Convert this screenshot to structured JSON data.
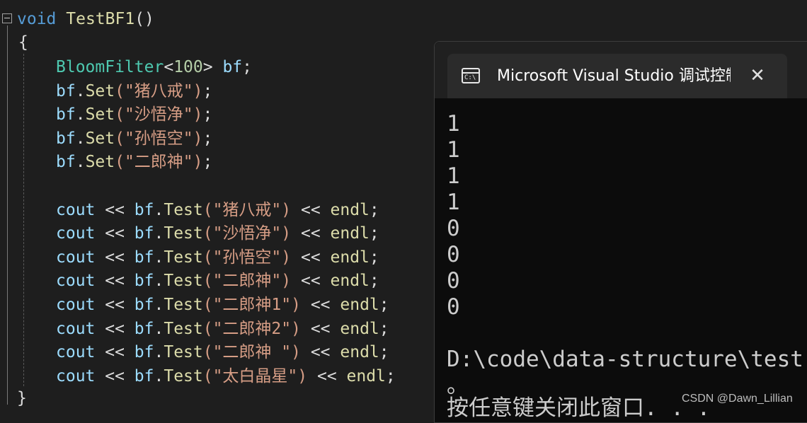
{
  "editor": {
    "function_keyword": "void",
    "function_name": "TestBF1",
    "function_parens": "()",
    "open_brace": "{",
    "close_brace": "}",
    "decl": {
      "type": "BloomFilter",
      "lt": "<",
      "size": "100",
      "gt": ">",
      "var": "bf",
      "semi": ";"
    },
    "set_lines": [
      {
        "obj": "bf",
        "method": "Set",
        "arg": "(\"猪八戒\")",
        "end": ";"
      },
      {
        "obj": "bf",
        "method": "Set",
        "arg": "(\"沙悟净\")",
        "end": ";"
      },
      {
        "obj": "bf",
        "method": "Set",
        "arg": "(\"孙悟空\")",
        "end": ";"
      },
      {
        "obj": "bf",
        "method": "Set",
        "arg": "(\"二郎神\")",
        "end": ";"
      }
    ],
    "cout_lines": [
      {
        "cout": "cout",
        "op": " << ",
        "obj": "bf",
        "method": "Test",
        "arg": "(\"猪八戒\")",
        "op2": " << ",
        "endl": "endl",
        "end": ";"
      },
      {
        "cout": "cout",
        "op": " << ",
        "obj": "bf",
        "method": "Test",
        "arg": "(\"沙悟净\")",
        "op2": " << ",
        "endl": "endl",
        "end": ";"
      },
      {
        "cout": "cout",
        "op": " << ",
        "obj": "bf",
        "method": "Test",
        "arg": "(\"孙悟空\")",
        "op2": " << ",
        "endl": "endl",
        "end": ";"
      },
      {
        "cout": "cout",
        "op": " << ",
        "obj": "bf",
        "method": "Test",
        "arg": "(\"二郎神\")",
        "op2": " << ",
        "endl": "endl",
        "end": ";"
      },
      {
        "cout": "cout",
        "op": " << ",
        "obj": "bf",
        "method": "Test",
        "arg": "(\"二郎神1\")",
        "op2": " << ",
        "endl": "endl",
        "end": ";"
      },
      {
        "cout": "cout",
        "op": " << ",
        "obj": "bf",
        "method": "Test",
        "arg": "(\"二郎神2\")",
        "op2": " << ",
        "endl": "endl",
        "end": ";"
      },
      {
        "cout": "cout",
        "op": " << ",
        "obj": "bf",
        "method": "Test",
        "arg": "(\"二郎神 \")",
        "op2": " << ",
        "endl": "endl",
        "end": ";"
      },
      {
        "cout": "cout",
        "op": " << ",
        "obj": "bf",
        "method": "Test",
        "arg": "(\"太白晶星\")",
        "op2": " << ",
        "endl": "endl",
        "end": ";"
      }
    ]
  },
  "console": {
    "icon": "console-app-icon",
    "icon_text": "C:\\",
    "title": "Microsoft Visual Studio 调试控制台",
    "close_glyph": "✕",
    "output": [
      "1",
      "1",
      "1",
      "1",
      "0",
      "0",
      "0",
      "0"
    ],
    "path_line": "D:\\code\\data-structure\\test",
    "period_line": "。",
    "prompt_line": "按任意键关闭此窗口. . ."
  },
  "watermark": "CSDN @Dawn_Lillian",
  "colors": {
    "keyword": "#569cd6",
    "function": "#dcdcaa",
    "type": "#4ec9b0",
    "string": "#d69d85",
    "variable": "#9cdcfe",
    "number": "#b5cea8"
  }
}
